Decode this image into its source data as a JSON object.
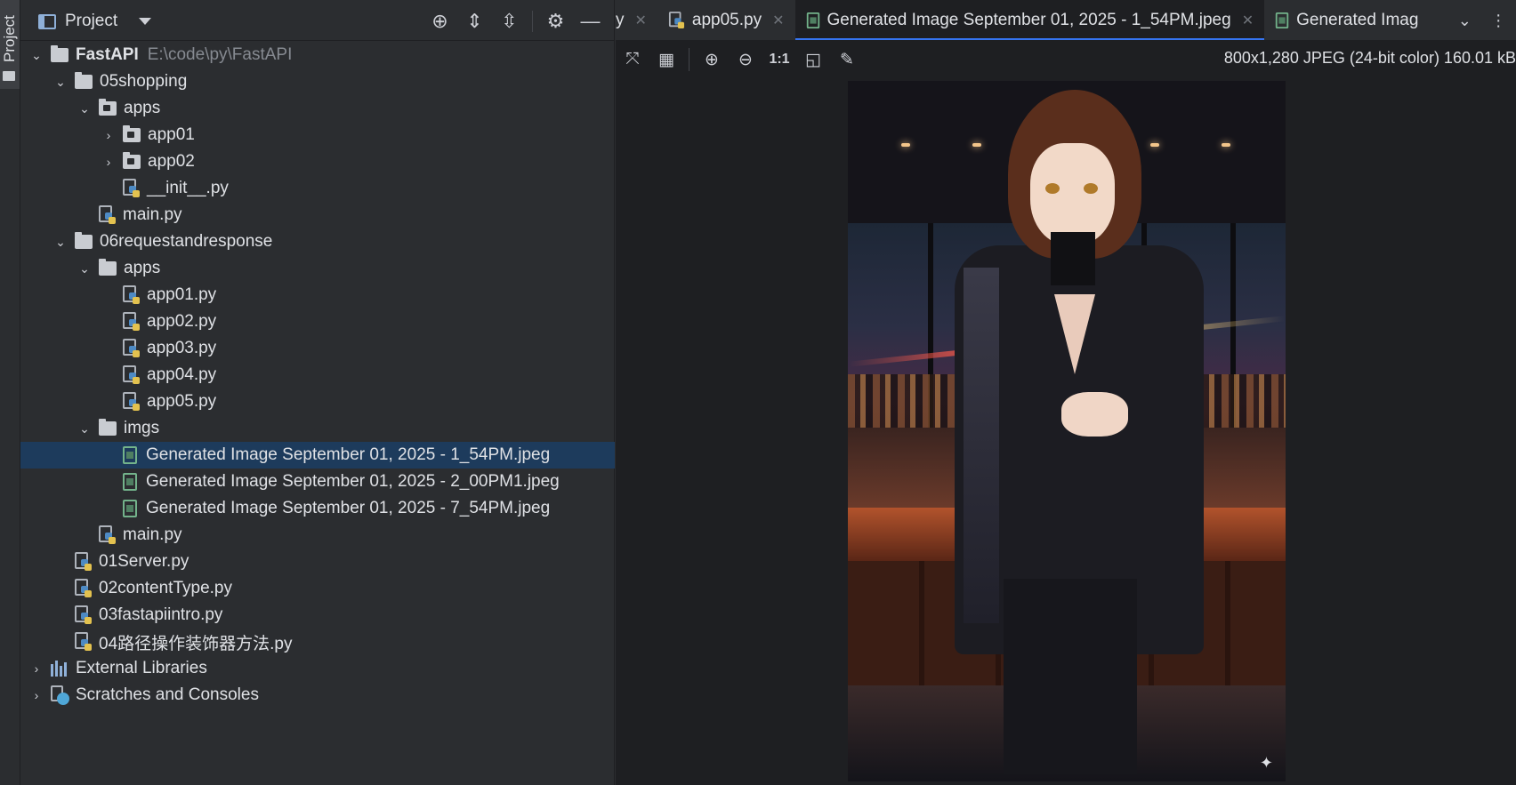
{
  "toolstrip": {
    "label": "Project"
  },
  "project_panel": {
    "title": "Project",
    "tree": [
      {
        "label": "FastAPI",
        "path": "E:\\code\\py\\FastAPI"
      },
      {
        "label": "05shopping"
      },
      {
        "label": "apps"
      },
      {
        "label": "app01"
      },
      {
        "label": "app02"
      },
      {
        "label": "__init__.py"
      },
      {
        "label": "main.py"
      },
      {
        "label": "06requestandresponse"
      },
      {
        "label": "apps"
      },
      {
        "label": "app01.py"
      },
      {
        "label": "app02.py"
      },
      {
        "label": "app03.py"
      },
      {
        "label": "app04.py"
      },
      {
        "label": "app05.py"
      },
      {
        "label": "imgs"
      },
      {
        "label": "Generated Image September 01, 2025 - 1_54PM.jpeg"
      },
      {
        "label": "Generated Image September 01, 2025 - 2_00PM1.jpeg"
      },
      {
        "label": "Generated Image September 01, 2025 - 7_54PM.jpeg"
      },
      {
        "label": "main.py"
      },
      {
        "label": "01Server.py"
      },
      {
        "label": "02contentType.py"
      },
      {
        "label": "03fastapiintro.py"
      },
      {
        "label": "04路径操作装饰器方法.py"
      },
      {
        "label": "External Libraries"
      },
      {
        "label": "Scratches and Consoles"
      }
    ]
  },
  "tabs": [
    {
      "label": "y"
    },
    {
      "label": "app05.py"
    },
    {
      "label": "Generated Image September 01, 2025 - 1_54PM.jpeg"
    },
    {
      "label": "Generated Imag"
    }
  ],
  "image_viewer": {
    "zoom_actual": "1:1",
    "info": "800x1,280 JPEG (24-bit color) 160.01 kB"
  },
  "colors": {
    "selection": "#1d3b5c",
    "accent": "#3574f0",
    "background": "#2b2d30"
  }
}
